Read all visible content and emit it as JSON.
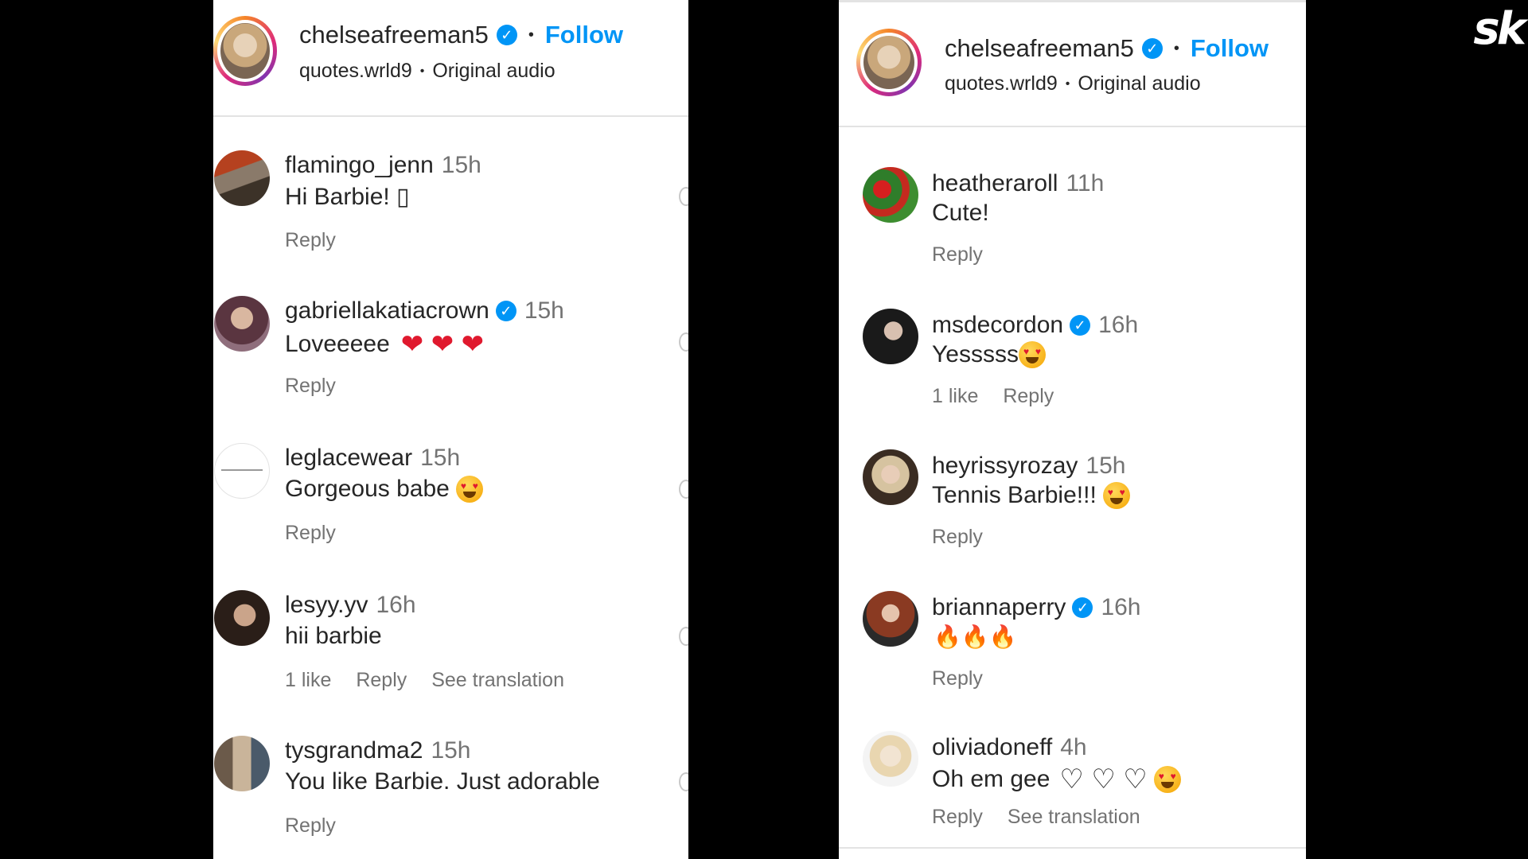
{
  "brand_logo": "sk",
  "left": {
    "header": {
      "username": "chelseafreeman5",
      "separator": "•",
      "follow_label": "Follow",
      "audio_user": "quotes.wrld9",
      "audio_separator": "•",
      "audio_label": "Original audio"
    },
    "comments": [
      {
        "user": "flamingo_jenn",
        "time": "15h",
        "text": "Hi Barbie! ▯",
        "actions": [
          "Reply"
        ]
      },
      {
        "user": "gabriellakatiacrown",
        "verified": true,
        "time": "15h",
        "text": "Loveeeee",
        "emoji": "❤ ❤ ❤",
        "actions": [
          "Reply"
        ]
      },
      {
        "user": "leglacewear",
        "time": "15h",
        "text": "Gorgeous babe",
        "actions": [
          "Reply"
        ]
      },
      {
        "user": "lesyy.yv",
        "time": "16h",
        "text": "hii barbie",
        "actions": [
          "1 like",
          "Reply",
          "See translation"
        ]
      },
      {
        "user": "tysgrandma2",
        "time": "15h",
        "text": "You like Barbie. Just adorable",
        "actions": [
          "Reply"
        ]
      }
    ]
  },
  "right": {
    "header": {
      "username": "chelseafreeman5",
      "separator": "•",
      "follow_label": "Follow",
      "audio_user": "quotes.wrld9",
      "audio_separator": "•",
      "audio_label": "Original audio"
    },
    "comments": [
      {
        "user": "heatheraroll",
        "time": "11h",
        "text": "Cute!",
        "actions": [
          "Reply"
        ]
      },
      {
        "user": "msdecordon",
        "verified": true,
        "time": "16h",
        "text": "Yesssss",
        "actions": [
          "1 like",
          "Reply"
        ]
      },
      {
        "user": "heyrissyrozay",
        "time": "15h",
        "text": "Tennis Barbie!!!",
        "actions": [
          "Reply"
        ]
      },
      {
        "user": "briannaperry",
        "verified": true,
        "time": "16h",
        "text": "",
        "emoji": "🔥🔥🔥",
        "actions": [
          "Reply"
        ]
      },
      {
        "user": "oliviadoneff",
        "time": "4h",
        "text": "Oh em gee",
        "emoji": "♡ ♡ ♡",
        "actions": [
          "Reply",
          "See translation"
        ]
      }
    ]
  },
  "colors": {
    "link_blue": "#0095f6",
    "verified_blue": "#0095f6",
    "secondary_text": "#737373",
    "background": "#000000",
    "panel": "#ffffff"
  }
}
